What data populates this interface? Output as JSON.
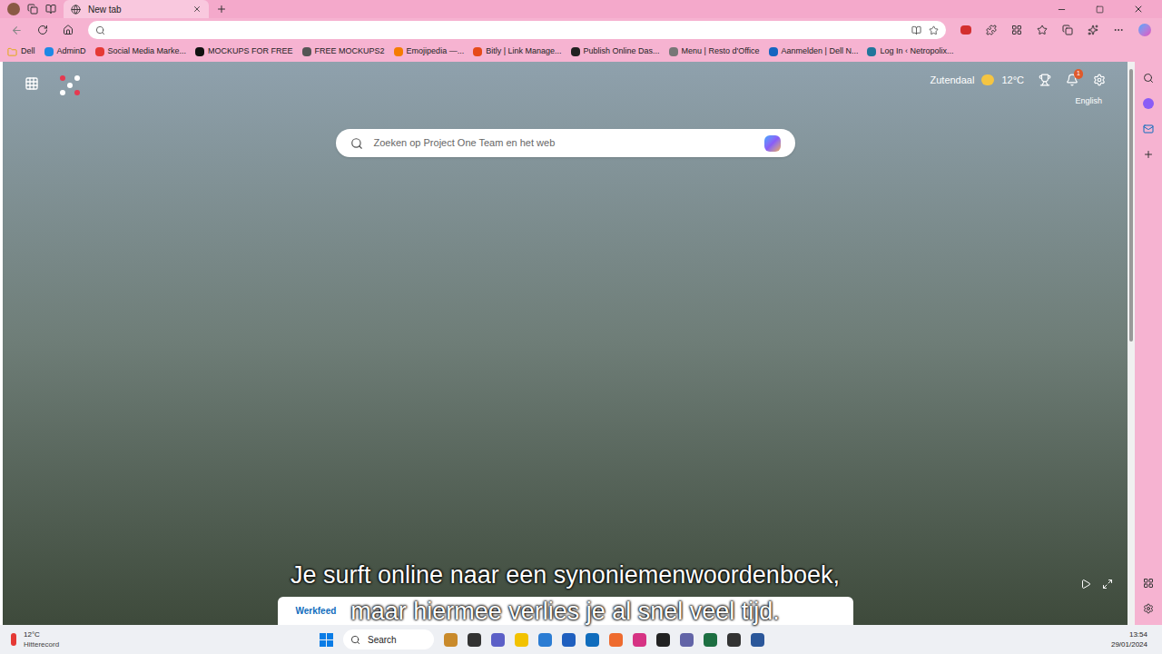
{
  "browser": {
    "tabs": [
      {
        "label": "New tab",
        "selected": true
      }
    ],
    "address": {
      "value": ""
    },
    "bookmarks": [
      "Dell",
      "AdminD",
      "Social Media Marke...",
      "MOCKUPS FOR FREE",
      "FREE MOCKUPS2",
      "Emojipedia —...",
      "Bitly | Link Manage...",
      "Publish Online Das...",
      "Menu | Resto d'Office",
      "Aanmelden | Dell N...",
      "Log In ‹ Netropolix..."
    ]
  },
  "newtab": {
    "location": "Zutendaal",
    "temperature": "12°C",
    "notifications": "1",
    "language": "English",
    "search": {
      "placeholder": "Zoeken op Project One Team en het web"
    },
    "feed": {
      "tabs": [
        {
          "label": "Werkfeed",
          "selected": true
        }
      ]
    }
  },
  "video": {
    "subtitles": [
      "Je surft online naar een synoniemenwoordenboek,",
      "maar hiermee verlies je al snel veel tijd."
    ]
  },
  "taskbar": {
    "weather": {
      "temperature": "12°C",
      "label": "Hitterecord"
    },
    "search": "Search",
    "time": "13:54",
    "date": "29/01/2024"
  }
}
